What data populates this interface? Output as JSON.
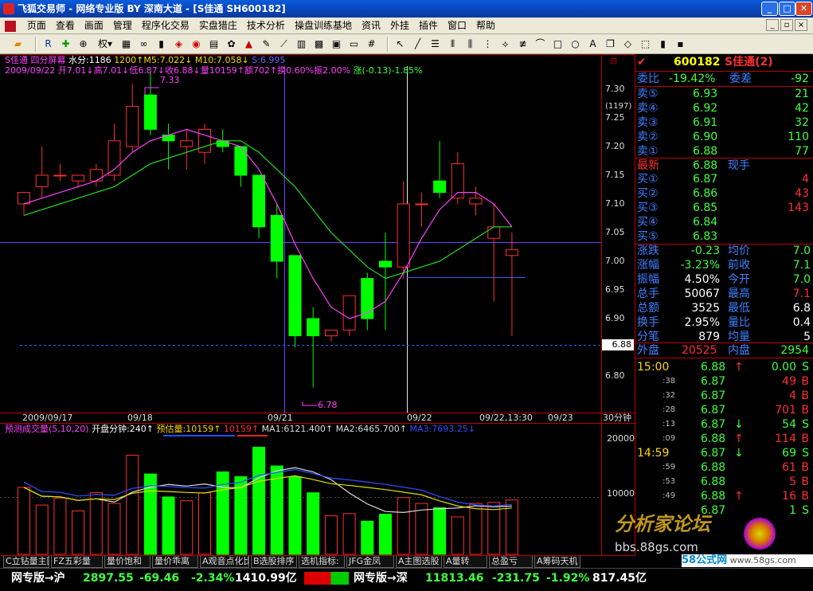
{
  "window": {
    "title": "飞狐交易师 - 网络专业版 BY 深南大道 - [S佳通 SH600182]"
  },
  "menu": [
    "页面",
    "查看",
    "画面",
    "管理",
    "程序化交易",
    "实盘猎庄",
    "技术分析",
    "操盘训练基地",
    "资讯",
    "外挂",
    "插件",
    "窗口",
    "帮助"
  ],
  "toolbar": {
    "right_label": "权"
  },
  "kline": {
    "title": "S佳通 四分屏幕",
    "water": "水分:1186",
    "ma5": "1200↑M5:7.022↓",
    "ma10": "M10:7.058↓",
    "ma_extra": "S:6.995",
    "info": "2009/09/22 开7.01↓高7.01↓低6.87↓收6.88↓量10159↑额702↑换0.60%振2.00%",
    "change": "涨(-0.13)-1.85%",
    "high_label": "7.33",
    "low_label": "6.78",
    "price_scale": [
      "7.30",
      "7.25",
      "7.20",
      "7.15",
      "7.10",
      "7.05",
      "7.00",
      "6.95",
      "6.90",
      "6.85",
      "6.80"
    ],
    "scale_extra": "(1197)",
    "cur_price": "6.88",
    "dates": [
      "2009/09/17",
      "09/18",
      "09/21",
      "09/22",
      "09/22,13:30",
      "09/23"
    ],
    "period": "30分钟",
    "colors": {
      "up": "#ff3030",
      "down": "#00ff00",
      "ma5": "#ff40ff",
      "ma10": "#20e020",
      "ma20": "#8060ff"
    }
  },
  "volume": {
    "title": "预测成交量(5,10,20)",
    "open_min": "开盘分钟:240↑",
    "est": "预估量:10159↑",
    "est2": "10159↑",
    "ma1": "MA1:6121.400↑",
    "ma2": "MA2:6465.700↑",
    "ma3": "MA3:7693.25↓",
    "scale": [
      "20000",
      "10000"
    ]
  },
  "chart_data": {
    "type": "candlestick",
    "title": "S佳通 四分屏幕",
    "xlabel": "",
    "ylabel": "",
    "ylim": [
      6.75,
      7.35
    ],
    "x": [
      "09/17",
      "09/17",
      "09/17",
      "09/17",
      "09/18",
      "09/18",
      "09/18",
      "09/18",
      "09/18",
      "09/18",
      "09/18",
      "09/18",
      "09/21",
      "09/21",
      "09/21",
      "09/21",
      "09/21",
      "09/21",
      "09/21",
      "09/21",
      "09/22",
      "09/22",
      "09/22",
      "09/22",
      "09/22",
      "09/22",
      "09/22",
      "09/22"
    ],
    "open": [
      7.1,
      7.13,
      7.15,
      7.14,
      7.14,
      7.15,
      7.2,
      7.29,
      7.22,
      7.2,
      7.19,
      7.21,
      7.2,
      7.15,
      7.08,
      7.01,
      6.9,
      6.87,
      6.88,
      6.97,
      7.0,
      6.99,
      7.1,
      7.14,
      7.11,
      7.1,
      7.04,
      7.01
    ],
    "close": [
      7.12,
      7.15,
      7.15,
      7.15,
      7.16,
      7.21,
      7.27,
      7.23,
      7.21,
      7.21,
      7.23,
      7.2,
      7.15,
      7.06,
      7.0,
      6.87,
      6.87,
      6.88,
      6.94,
      6.9,
      6.99,
      7.1,
      7.1,
      7.12,
      7.17,
      7.11,
      7.06,
      7.02
    ],
    "high": [
      7.12,
      7.2,
      7.17,
      7.15,
      7.17,
      7.24,
      7.31,
      7.33,
      7.24,
      7.23,
      7.24,
      7.23,
      7.2,
      7.15,
      7.1,
      7.01,
      6.92,
      6.88,
      6.89,
      6.98,
      7.05,
      7.14,
      7.12,
      7.21,
      7.19,
      7.13,
      7.1,
      7.05
    ],
    "low": [
      7.08,
      7.11,
      7.14,
      7.13,
      7.13,
      7.14,
      7.19,
      7.22,
      7.16,
      7.16,
      7.17,
      7.19,
      7.13,
      7.04,
      6.97,
      6.85,
      6.78,
      6.86,
      6.87,
      6.88,
      6.88,
      6.97,
      7.06,
      7.11,
      7.1,
      7.08,
      6.93,
      6.87
    ],
    "ma5": [
      7.1,
      7.11,
      7.12,
      7.13,
      7.14,
      7.16,
      7.19,
      7.21,
      7.22,
      7.23,
      7.22,
      7.21,
      7.2,
      7.16,
      7.1,
      7.03,
      6.97,
      6.92,
      6.9,
      6.91,
      6.93,
      6.98,
      7.04,
      7.09,
      7.12,
      7.12,
      7.1,
      7.06
    ],
    "ma10": [
      7.08,
      7.09,
      7.1,
      7.11,
      7.12,
      7.13,
      7.15,
      7.17,
      7.18,
      7.19,
      7.2,
      7.21,
      7.21,
      7.19,
      7.16,
      7.13,
      7.09,
      7.05,
      7.02,
      6.99,
      6.97,
      6.98,
      6.99,
      7.0,
      7.02,
      7.04,
      7.06,
      7.06
    ],
    "volume": [
      12500,
      9200,
      10500,
      8100,
      11500,
      9500,
      18500,
      15000,
      10700,
      10000,
      11500,
      15400,
      14500,
      20000,
      16500,
      14500,
      11500,
      7200,
      7600,
      6200,
      7500,
      10600,
      9500,
      8700,
      7000,
      9500,
      9700,
      10160
    ]
  },
  "quote": {
    "code": "600182",
    "name": "S佳通(2)",
    "weibi_label": "委比",
    "weibi": "-19.42%",
    "weicha_label": "委差",
    "weicha": "-92",
    "sells": [
      {
        "label": "卖⑤",
        "price": "6.93",
        "vol": "21"
      },
      {
        "label": "卖④",
        "price": "6.92",
        "vol": "42"
      },
      {
        "label": "卖③",
        "price": "6.91",
        "vol": "32"
      },
      {
        "label": "卖②",
        "price": "6.90",
        "vol": "110"
      },
      {
        "label": "卖①",
        "price": "6.88",
        "vol": "77"
      }
    ],
    "latest_label": "最新",
    "latest": "6.88",
    "xianshou_label": "现手",
    "buys": [
      {
        "label": "买①",
        "price": "6.87",
        "vol": "4"
      },
      {
        "label": "买②",
        "price": "6.86",
        "vol": "43"
      },
      {
        "label": "买③",
        "price": "6.85",
        "vol": "143"
      },
      {
        "label": "买④",
        "price": "6.84",
        "vol": ""
      },
      {
        "label": "买⑤",
        "price": "6.83",
        "vol": ""
      }
    ],
    "stats": [
      {
        "l1": "涨跌",
        "v1": "-0.23",
        "l2": "均价",
        "v2": "7.0"
      },
      {
        "l1": "涨幅",
        "v1": "-3.23%",
        "l2": "前收",
        "v2": "7.1"
      },
      {
        "l1": "振幅",
        "v1": "4.50%",
        "l2": "今开",
        "v2": "7.0"
      },
      {
        "l1": "总手",
        "v1": "50067",
        "l2": "最高",
        "v2": "7.1"
      },
      {
        "l1": "总额",
        "v1": "3525",
        "l2": "最低",
        "v2": "6.8"
      },
      {
        "l1": "换手",
        "v1": "2.95%",
        "l2": "量比",
        "v2": "0.4"
      },
      {
        "l1": "分笔",
        "v1": "879",
        "l2": "均量",
        "v2": "5"
      }
    ],
    "waipan_label": "外盘",
    "waipan": "20525",
    "neipan_label": "内盘",
    "neipan": "2954",
    "ticks": [
      {
        "t": "15:00",
        "p": "6.88",
        "arr": "↑",
        "v": "0.00",
        "s": "S"
      },
      {
        "t": ":38",
        "p": "6.87",
        "arr": "",
        "v": "49",
        "s": "B"
      },
      {
        "t": ":32",
        "p": "6.87",
        "arr": "",
        "v": "4",
        "s": "B"
      },
      {
        "t": ":28",
        "p": "6.87",
        "arr": "",
        "v": "701",
        "s": "B"
      },
      {
        "t": ":13",
        "p": "6.87",
        "arr": "↓",
        "v": "54",
        "s": "S"
      },
      {
        "t": ":09",
        "p": "6.88",
        "arr": "↑",
        "v": "114",
        "s": "B"
      },
      {
        "t": "14:59",
        "p": "6.87",
        "arr": "↓",
        "v": "69",
        "s": "S"
      },
      {
        "t": ":59",
        "p": "6.88",
        "arr": "",
        "v": "61",
        "s": "B"
      },
      {
        "t": ":53",
        "p": "6.88",
        "arr": "",
        "v": "5",
        "s": "B"
      },
      {
        "t": ":49",
        "p": "6.88",
        "arr": "↑",
        "v": "16",
        "s": "B"
      },
      {
        "t": "",
        "p": "6.87",
        "arr": "",
        "v": "1",
        "s": "S"
      }
    ]
  },
  "tabs": [
    "C立钻量主图",
    "FZ五彩量",
    "量价饱和",
    "量价乖离",
    "A观音点化比",
    "B选股排序",
    "选机指标:",
    "JFG金凤",
    "A主图选股",
    "A量转",
    "总盈亏",
    "A筹码天机"
  ],
  "statusbar": {
    "sh_label": "网专版→沪",
    "sh_val": "2897.55",
    "sh_chg": "-69.46",
    "sh_pct": "-2.34%",
    "sh_amt": "1410.99亿",
    "sz_label": "网专版→深",
    "sz_val": "11813.46",
    "sz_chg": "-231.75",
    "sz_pct": "-1.92%",
    "sz_amt": "817.45亿"
  },
  "watermark": {
    "text1": "分析家论坛",
    "text2": "bbs.88gs.com",
    "text3": "58公式网",
    "text4": "www.58gs.com"
  }
}
